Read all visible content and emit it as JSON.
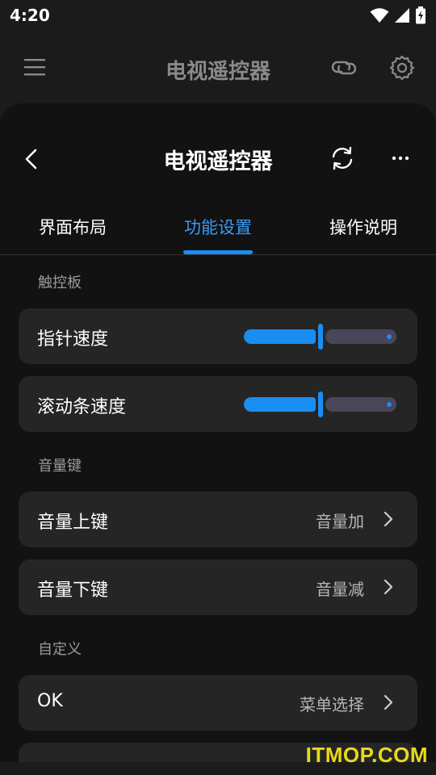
{
  "status": {
    "time": "4:20"
  },
  "appbar": {
    "title": "电视遥控器"
  },
  "sheet": {
    "title": "电视遥控器",
    "tabs": [
      {
        "label": "界面布局",
        "active": false
      },
      {
        "label": "功能设置",
        "active": true
      },
      {
        "label": "操作说明",
        "active": false
      }
    ],
    "sections": {
      "touchpad": {
        "label": "触控板",
        "items": [
          {
            "label": "指针速度",
            "level": 0.5
          },
          {
            "label": "滚动条速度",
            "level": 0.5
          }
        ]
      },
      "volume": {
        "label": "音量键",
        "items": [
          {
            "label": "音量上键",
            "value": "音量加"
          },
          {
            "label": "音量下键",
            "value": "音量减"
          }
        ]
      },
      "custom": {
        "label": "自定义",
        "items": [
          {
            "label": "OK",
            "value": "菜单选择"
          }
        ]
      }
    }
  },
  "watermark": "ITMOP.COM",
  "colors": {
    "accent": "#1a8ef0",
    "card": "#252525",
    "background": "#121212"
  },
  "icons": [
    "wifi-icon",
    "signal-icon",
    "battery-icon",
    "menu-icon",
    "link-icon",
    "gear-icon",
    "back-icon",
    "refresh-icon",
    "more-icon",
    "chevron-right-icon"
  ]
}
